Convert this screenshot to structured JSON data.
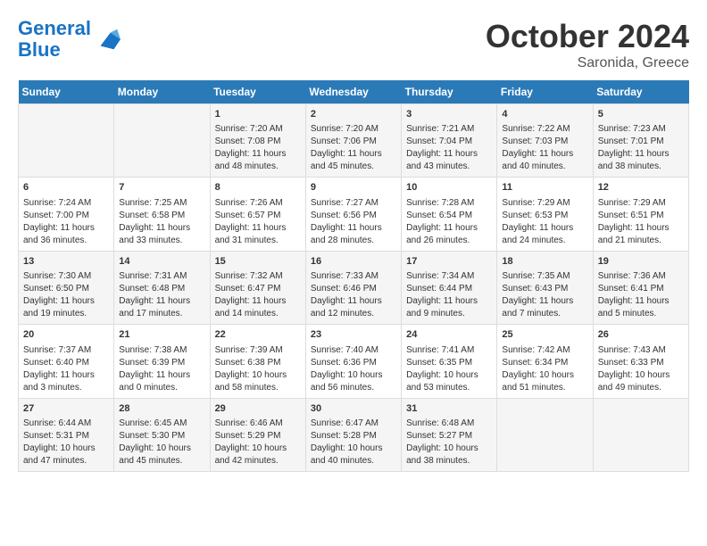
{
  "header": {
    "logo_line1": "General",
    "logo_line2": "Blue",
    "month": "October 2024",
    "location": "Saronida, Greece"
  },
  "weekdays": [
    "Sunday",
    "Monday",
    "Tuesday",
    "Wednesday",
    "Thursday",
    "Friday",
    "Saturday"
  ],
  "weeks": [
    [
      {
        "day": "",
        "sunrise": "",
        "sunset": "",
        "daylight": ""
      },
      {
        "day": "",
        "sunrise": "",
        "sunset": "",
        "daylight": ""
      },
      {
        "day": "1",
        "sunrise": "Sunrise: 7:20 AM",
        "sunset": "Sunset: 7:08 PM",
        "daylight": "Daylight: 11 hours and 48 minutes."
      },
      {
        "day": "2",
        "sunrise": "Sunrise: 7:20 AM",
        "sunset": "Sunset: 7:06 PM",
        "daylight": "Daylight: 11 hours and 45 minutes."
      },
      {
        "day": "3",
        "sunrise": "Sunrise: 7:21 AM",
        "sunset": "Sunset: 7:04 PM",
        "daylight": "Daylight: 11 hours and 43 minutes."
      },
      {
        "day": "4",
        "sunrise": "Sunrise: 7:22 AM",
        "sunset": "Sunset: 7:03 PM",
        "daylight": "Daylight: 11 hours and 40 minutes."
      },
      {
        "day": "5",
        "sunrise": "Sunrise: 7:23 AM",
        "sunset": "Sunset: 7:01 PM",
        "daylight": "Daylight: 11 hours and 38 minutes."
      }
    ],
    [
      {
        "day": "6",
        "sunrise": "Sunrise: 7:24 AM",
        "sunset": "Sunset: 7:00 PM",
        "daylight": "Daylight: 11 hours and 36 minutes."
      },
      {
        "day": "7",
        "sunrise": "Sunrise: 7:25 AM",
        "sunset": "Sunset: 6:58 PM",
        "daylight": "Daylight: 11 hours and 33 minutes."
      },
      {
        "day": "8",
        "sunrise": "Sunrise: 7:26 AM",
        "sunset": "Sunset: 6:57 PM",
        "daylight": "Daylight: 11 hours and 31 minutes."
      },
      {
        "day": "9",
        "sunrise": "Sunrise: 7:27 AM",
        "sunset": "Sunset: 6:56 PM",
        "daylight": "Daylight: 11 hours and 28 minutes."
      },
      {
        "day": "10",
        "sunrise": "Sunrise: 7:28 AM",
        "sunset": "Sunset: 6:54 PM",
        "daylight": "Daylight: 11 hours and 26 minutes."
      },
      {
        "day": "11",
        "sunrise": "Sunrise: 7:29 AM",
        "sunset": "Sunset: 6:53 PM",
        "daylight": "Daylight: 11 hours and 24 minutes."
      },
      {
        "day": "12",
        "sunrise": "Sunrise: 7:29 AM",
        "sunset": "Sunset: 6:51 PM",
        "daylight": "Daylight: 11 hours and 21 minutes."
      }
    ],
    [
      {
        "day": "13",
        "sunrise": "Sunrise: 7:30 AM",
        "sunset": "Sunset: 6:50 PM",
        "daylight": "Daylight: 11 hours and 19 minutes."
      },
      {
        "day": "14",
        "sunrise": "Sunrise: 7:31 AM",
        "sunset": "Sunset: 6:48 PM",
        "daylight": "Daylight: 11 hours and 17 minutes."
      },
      {
        "day": "15",
        "sunrise": "Sunrise: 7:32 AM",
        "sunset": "Sunset: 6:47 PM",
        "daylight": "Daylight: 11 hours and 14 minutes."
      },
      {
        "day": "16",
        "sunrise": "Sunrise: 7:33 AM",
        "sunset": "Sunset: 6:46 PM",
        "daylight": "Daylight: 11 hours and 12 minutes."
      },
      {
        "day": "17",
        "sunrise": "Sunrise: 7:34 AM",
        "sunset": "Sunset: 6:44 PM",
        "daylight": "Daylight: 11 hours and 9 minutes."
      },
      {
        "day": "18",
        "sunrise": "Sunrise: 7:35 AM",
        "sunset": "Sunset: 6:43 PM",
        "daylight": "Daylight: 11 hours and 7 minutes."
      },
      {
        "day": "19",
        "sunrise": "Sunrise: 7:36 AM",
        "sunset": "Sunset: 6:41 PM",
        "daylight": "Daylight: 11 hours and 5 minutes."
      }
    ],
    [
      {
        "day": "20",
        "sunrise": "Sunrise: 7:37 AM",
        "sunset": "Sunset: 6:40 PM",
        "daylight": "Daylight: 11 hours and 3 minutes."
      },
      {
        "day": "21",
        "sunrise": "Sunrise: 7:38 AM",
        "sunset": "Sunset: 6:39 PM",
        "daylight": "Daylight: 11 hours and 0 minutes."
      },
      {
        "day": "22",
        "sunrise": "Sunrise: 7:39 AM",
        "sunset": "Sunset: 6:38 PM",
        "daylight": "Daylight: 10 hours and 58 minutes."
      },
      {
        "day": "23",
        "sunrise": "Sunrise: 7:40 AM",
        "sunset": "Sunset: 6:36 PM",
        "daylight": "Daylight: 10 hours and 56 minutes."
      },
      {
        "day": "24",
        "sunrise": "Sunrise: 7:41 AM",
        "sunset": "Sunset: 6:35 PM",
        "daylight": "Daylight: 10 hours and 53 minutes."
      },
      {
        "day": "25",
        "sunrise": "Sunrise: 7:42 AM",
        "sunset": "Sunset: 6:34 PM",
        "daylight": "Daylight: 10 hours and 51 minutes."
      },
      {
        "day": "26",
        "sunrise": "Sunrise: 7:43 AM",
        "sunset": "Sunset: 6:33 PM",
        "daylight": "Daylight: 10 hours and 49 minutes."
      }
    ],
    [
      {
        "day": "27",
        "sunrise": "Sunrise: 6:44 AM",
        "sunset": "Sunset: 5:31 PM",
        "daylight": "Daylight: 10 hours and 47 minutes."
      },
      {
        "day": "28",
        "sunrise": "Sunrise: 6:45 AM",
        "sunset": "Sunset: 5:30 PM",
        "daylight": "Daylight: 10 hours and 45 minutes."
      },
      {
        "day": "29",
        "sunrise": "Sunrise: 6:46 AM",
        "sunset": "Sunset: 5:29 PM",
        "daylight": "Daylight: 10 hours and 42 minutes."
      },
      {
        "day": "30",
        "sunrise": "Sunrise: 6:47 AM",
        "sunset": "Sunset: 5:28 PM",
        "daylight": "Daylight: 10 hours and 40 minutes."
      },
      {
        "day": "31",
        "sunrise": "Sunrise: 6:48 AM",
        "sunset": "Sunset: 5:27 PM",
        "daylight": "Daylight: 10 hours and 38 minutes."
      },
      {
        "day": "",
        "sunrise": "",
        "sunset": "",
        "daylight": ""
      },
      {
        "day": "",
        "sunrise": "",
        "sunset": "",
        "daylight": ""
      }
    ]
  ]
}
